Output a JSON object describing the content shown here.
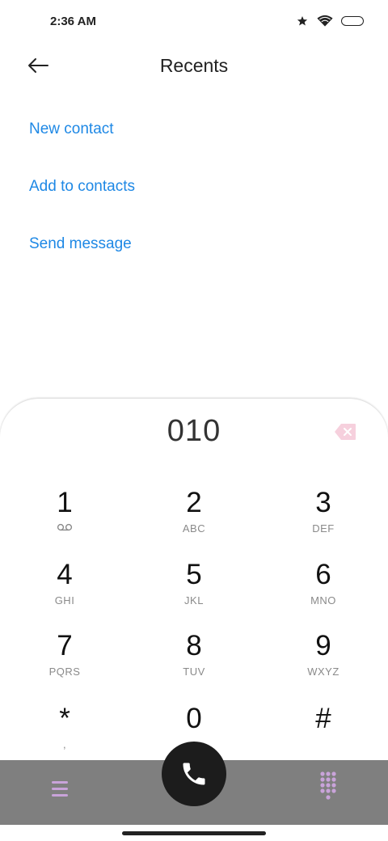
{
  "status_bar": {
    "time": "2:36 AM",
    "icons": [
      "star-icon",
      "wifi-icon",
      "battery-icon"
    ]
  },
  "header": {
    "title": "Recents",
    "back_icon": "back-arrow-icon"
  },
  "actions": [
    {
      "label": "New contact"
    },
    {
      "label": "Add to contacts"
    },
    {
      "label": "Send message"
    }
  ],
  "dialer": {
    "number": "010",
    "backspace_icon": "backspace-icon",
    "keys": [
      {
        "digit": "1",
        "letters": "",
        "sub_icon": "voicemail-icon"
      },
      {
        "digit": "2",
        "letters": "ABC"
      },
      {
        "digit": "3",
        "letters": "DEF"
      },
      {
        "digit": "4",
        "letters": "GHI"
      },
      {
        "digit": "5",
        "letters": "JKL"
      },
      {
        "digit": "6",
        "letters": "MNO"
      },
      {
        "digit": "7",
        "letters": "PQRS"
      },
      {
        "digit": "8",
        "letters": "TUV"
      },
      {
        "digit": "9",
        "letters": "WXYZ"
      },
      {
        "digit": "*",
        "letters": ","
      },
      {
        "digit": "0",
        "letters": "+"
      },
      {
        "digit": "#",
        "letters": ""
      }
    ]
  },
  "bottom_bar": {
    "menu_icon": "menu-icon",
    "call_icon": "phone-icon",
    "keypad_icon": "dialpad-icon"
  },
  "colors": {
    "accent": "#1E88E5",
    "bottom_bar": "#7F7F7F",
    "call_button": "#1C1C1C",
    "icon_tint": "#C9A3DA",
    "backspace": "#F6D0DD"
  }
}
